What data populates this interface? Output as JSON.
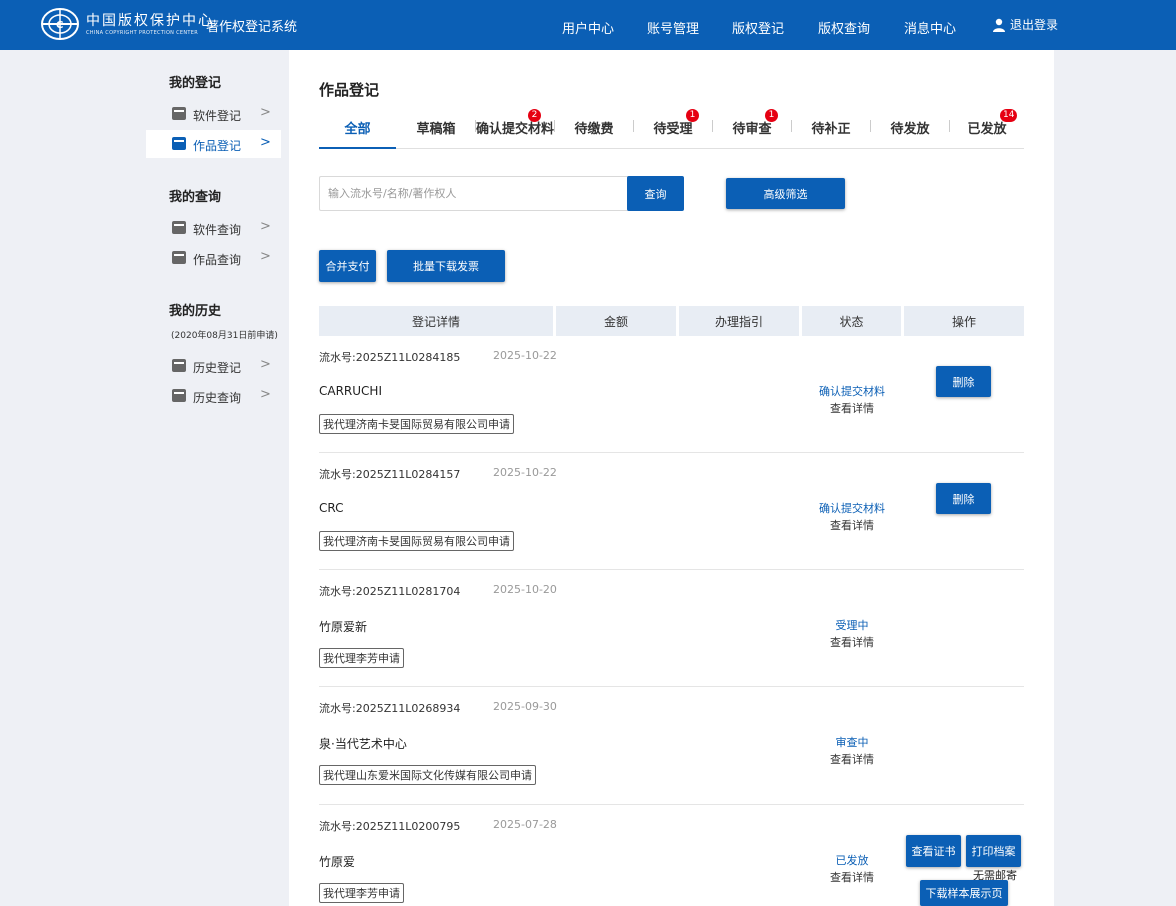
{
  "header": {
    "logo_cn": "中国版权保护中心",
    "logo_en": "CHINA COPYRIGHT PROTECTION CENTER",
    "system_title": "著作权登记系统",
    "nav": [
      "用户中心",
      "账号管理",
      "版权登记",
      "版权查询",
      "消息中心"
    ],
    "logout": "退出登录"
  },
  "sidebar": {
    "sections": [
      {
        "title": "我的登记",
        "items": [
          {
            "label": "软件登记",
            "active": false
          },
          {
            "label": "作品登记",
            "active": true
          }
        ]
      },
      {
        "title": "我的查询",
        "items": [
          {
            "label": "软件查询",
            "active": false
          },
          {
            "label": "作品查询",
            "active": false
          }
        ]
      },
      {
        "title": "我的历史",
        "note": "(2020年08月31日前申请)",
        "items": [
          {
            "label": "历史登记",
            "active": false
          },
          {
            "label": "历史查询",
            "active": false
          }
        ]
      }
    ],
    "chevron": ">"
  },
  "main": {
    "title": "作品登记",
    "tabs": [
      {
        "label": "全部",
        "badge": ""
      },
      {
        "label": "草稿箱",
        "badge": ""
      },
      {
        "label": "确认提交材料",
        "badge": "2"
      },
      {
        "label": "待缴费",
        "badge": ""
      },
      {
        "label": "待受理",
        "badge": "1"
      },
      {
        "label": "待审查",
        "badge": "1"
      },
      {
        "label": "待补正",
        "badge": ""
      },
      {
        "label": "待发放",
        "badge": ""
      },
      {
        "label": "已发放",
        "badge": "14"
      }
    ],
    "search": {
      "placeholder": "输入流水号/名称/著作权人",
      "button": "查询",
      "advanced": "高级筛选"
    },
    "actions": {
      "merge_pay": "合并支付",
      "batch_invoice": "批量下载发票"
    },
    "table_headers": [
      "登记详情",
      "金额",
      "办理指引",
      "状态",
      "操作"
    ],
    "records": [
      {
        "serial": "流水号:2025Z11L0284185",
        "date": "2025-10-22",
        "name": "CARRUCHI",
        "agent": "我代理济南卡旻国际贸易有限公司申请",
        "status": "确认提交材料",
        "detail": "查看详情",
        "buttons": [
          "删除"
        ]
      },
      {
        "serial": "流水号:2025Z11L0284157",
        "date": "2025-10-22",
        "name": "CRC",
        "agent": "我代理济南卡旻国际贸易有限公司申请",
        "status": "确认提交材料",
        "detail": "查看详情",
        "buttons": [
          "删除"
        ]
      },
      {
        "serial": "流水号:2025Z11L0281704",
        "date": "2025-10-20",
        "name": "竹原爱新",
        "agent": "我代理李芳申请",
        "status": "受理中",
        "detail": "查看详情",
        "buttons": []
      },
      {
        "serial": "流水号:2025Z11L0268934",
        "date": "2025-09-30",
        "name": "泉·当代艺术中心",
        "agent": "我代理山东爱米国际文化传媒有限公司申请",
        "status": "审查中",
        "detail": "查看详情",
        "buttons": []
      },
      {
        "serial": "流水号:2025Z11L0200795",
        "date": "2025-07-28",
        "name": "竹原爱",
        "agent": "我代理李芳申请",
        "status": "已发放",
        "detail": "查看详情",
        "buttons": [
          "查看证书",
          "打印档案",
          "下载样本展示页"
        ],
        "note": "无需邮寄"
      }
    ]
  }
}
